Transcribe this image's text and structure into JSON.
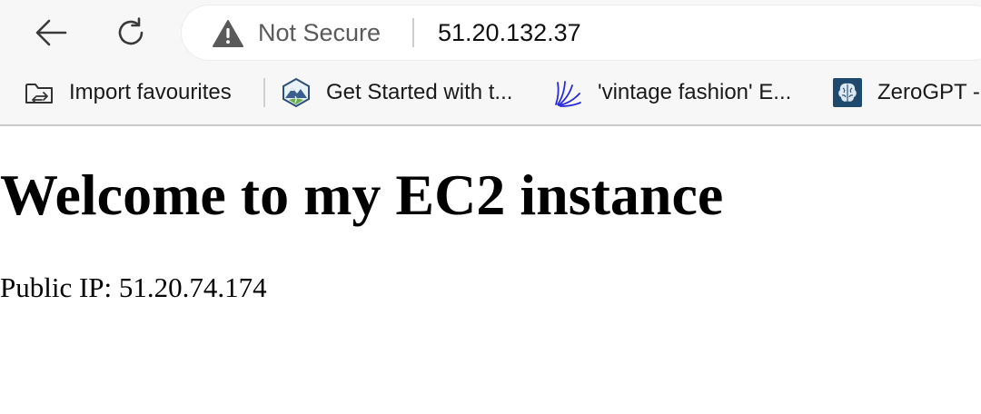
{
  "toolbar": {
    "back_icon": "arrow-left-icon",
    "reload_icon": "reload-icon",
    "security_icon": "warning-triangle-icon",
    "security_label": "Not Secure",
    "url": "51.20.132.37"
  },
  "bookmarks": [
    {
      "label": "Import favourites",
      "icon": "import-folder-icon"
    },
    {
      "label": "Get Started with t...",
      "icon": "mountain-badge-icon"
    },
    {
      "label": "'vintage fashion' E...",
      "icon": "blue-scribble-icon"
    },
    {
      "label": "ZeroGPT -",
      "icon": "brain-icon"
    }
  ],
  "page": {
    "title": "Welcome to my EC2 instance",
    "public_ip_text": "Public IP: 51.20.74.174"
  },
  "colors": {
    "toolbar_bg": "#f7f7f7",
    "warning_icon": "#5a5a5a",
    "bookmark_scribble": "#2a2ad6",
    "brain_tile": "#1f4a6e"
  }
}
